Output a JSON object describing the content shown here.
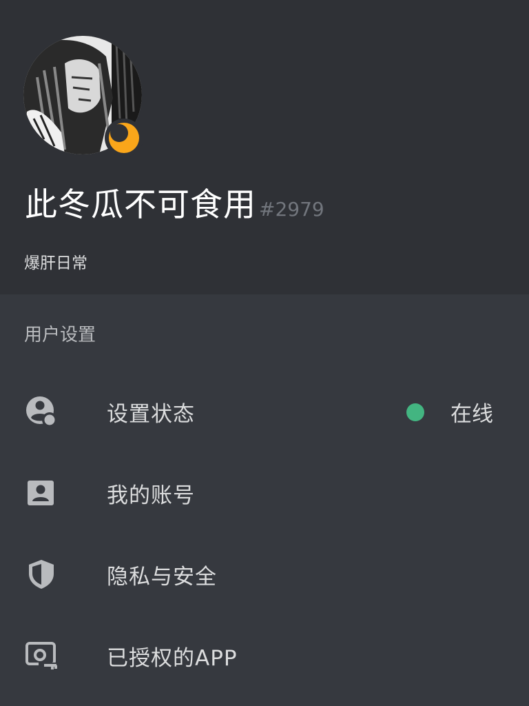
{
  "profile": {
    "username": "此冬瓜不可食用",
    "discriminator": "#2979",
    "custom_status": "爆肝日常",
    "status_badge_color": "#faa61a",
    "avatar_icon": "user-avatar-image"
  },
  "settings": {
    "section_title": "用户设置",
    "items": [
      {
        "label": "设置状态",
        "icon": "status-icon",
        "value": "在线",
        "value_color": "#43b581"
      },
      {
        "label": "我的账号",
        "icon": "account-icon"
      },
      {
        "label": "隐私与安全",
        "icon": "shield-icon"
      },
      {
        "label": "已授权的APP",
        "icon": "authorized-apps-icon"
      }
    ]
  }
}
